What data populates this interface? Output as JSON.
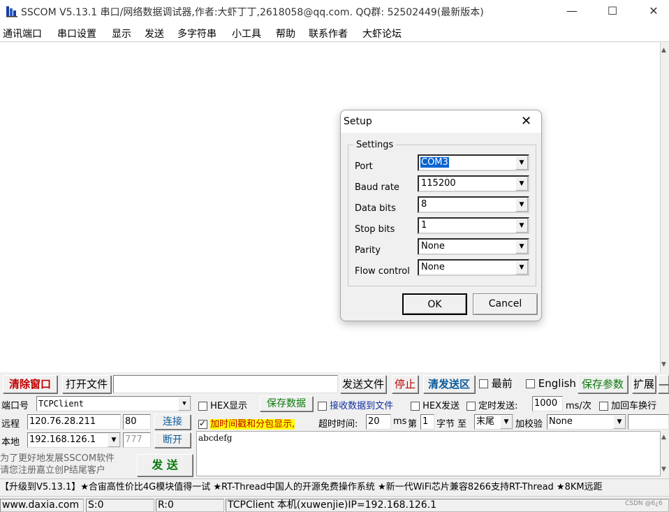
{
  "window": {
    "title": "SSCOM V5.13.1 串口/网络数据调试器,作者:大虾丁丁,2618058@qq.com. QQ群:  52502449(最新版本)",
    "minimize": "—",
    "maximize": "☐",
    "close": "✕"
  },
  "menu": [
    "通讯端口",
    "串口设置",
    "显示",
    "发送",
    "多字符串",
    "小工具",
    "帮助",
    "联系作者",
    "大虾论坛"
  ],
  "dialog": {
    "title": "Setup",
    "close": "✕",
    "group_label": "Settings",
    "fields": [
      {
        "label": "Port",
        "value": "COM3"
      },
      {
        "label": "Baud rate",
        "value": "115200"
      },
      {
        "label": "Data bits",
        "value": "8"
      },
      {
        "label": "Stop bits",
        "value": "1"
      },
      {
        "label": "Parity",
        "value": "None"
      },
      {
        "label": "Flow control",
        "value": "None"
      }
    ],
    "ok": "OK",
    "cancel": "Cancel"
  },
  "toolbar": {
    "clear_window": "清除窗口",
    "open_file": "打开文件",
    "file_path": "",
    "send_file": "发送文件",
    "stop": "停止",
    "clear_send": "清发送区",
    "topmost": "最前",
    "english": "English",
    "save_params": "保存参数",
    "expand": "扩展",
    "dash": "—"
  },
  "conn": {
    "port_label": "端口号",
    "port_value": "TCPClient",
    "remote_label": "远程",
    "remote_ip": "120.76.28.211",
    "remote_port": "80",
    "connect": "连接",
    "local_label": "本地",
    "local_ip": "192.168.126.1",
    "local_port": "777",
    "disconnect": "断开",
    "promo_line1": "为了更好地发展SSCOM软件",
    "promo_line2": "请您注册嘉立创P结尾客户",
    "send": "发 送"
  },
  "options": {
    "hex_display": "HEX显示",
    "save_data": "保存数据",
    "recv_to_file": "接收数据到文件",
    "hex_send": "HEX发送",
    "timed_send": "定时发送:",
    "interval": "1000",
    "interval_unit": "ms/次",
    "add_crlf": "加回车换行",
    "add_timestamp": "加时间戳和分包显示,",
    "timeout_label": "超时时间:",
    "timeout": "20",
    "timeout_unit": "ms",
    "byte_prefix": "第",
    "byte_index": "1",
    "byte_suffix": "字节 至",
    "byte_end": "末尾",
    "checksum_label": "加校验",
    "checksum": "None"
  },
  "send_text": "abcdefg",
  "marquee": "【升级到V5.13.1】★合宙高性价比4G模块值得一试 ★RT-Thread中国人的开源免费操作系统 ★新一代WiFi芯片兼容8266支持RT-Thread ★8KM远距",
  "status": {
    "website": "www.daxia.com",
    "sent": "S:0",
    "received": "R:0",
    "connection": "TCPClient 本机(xuwenjie)IP=192.168.126.1",
    "watermark": "CSDN @6¿6"
  }
}
